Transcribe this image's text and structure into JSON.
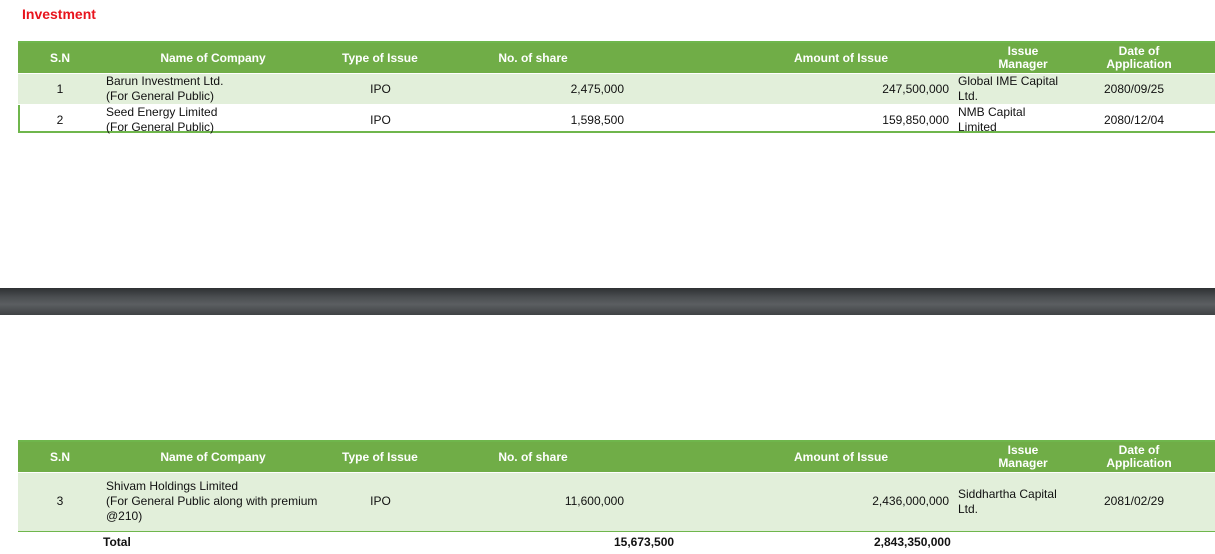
{
  "title": "Investment",
  "headers": {
    "sn": "S.N",
    "company": "Name of Company",
    "type": "Type of Issue",
    "shares": "No. of share",
    "amount": "Amount of Issue",
    "manager": "Issue Manager",
    "date_line1": "Date of",
    "date_line2": "Application"
  },
  "table1": [
    {
      "sn": "1",
      "name": "Barun Investment Ltd.",
      "note": "(For General Public)",
      "type": "IPO",
      "shares": "2,475,000",
      "amount": "247,500,000",
      "manager": "Global IME Capital Ltd.",
      "date": "2080/09/25"
    },
    {
      "sn": "2",
      "name": "Seed Energy Limited",
      "note": "(For General Public)",
      "type": "IPO",
      "shares": "1,598,500",
      "amount": "159,850,000",
      "manager": "NMB Capital Limited",
      "date": "2080/12/04"
    }
  ],
  "table2": [
    {
      "sn": "3",
      "name": "Shivam Holdings Limited",
      "note": "(For General Public along with premium",
      "note2": "@210)",
      "type": "IPO",
      "shares": "11,600,000",
      "amount": "2,436,000,000",
      "manager": "Siddhartha Capital Ltd.",
      "date": "2081/02/29"
    }
  ],
  "total": {
    "label": "Total",
    "shares": "15,673,500",
    "amount": "2,843,350,000"
  }
}
